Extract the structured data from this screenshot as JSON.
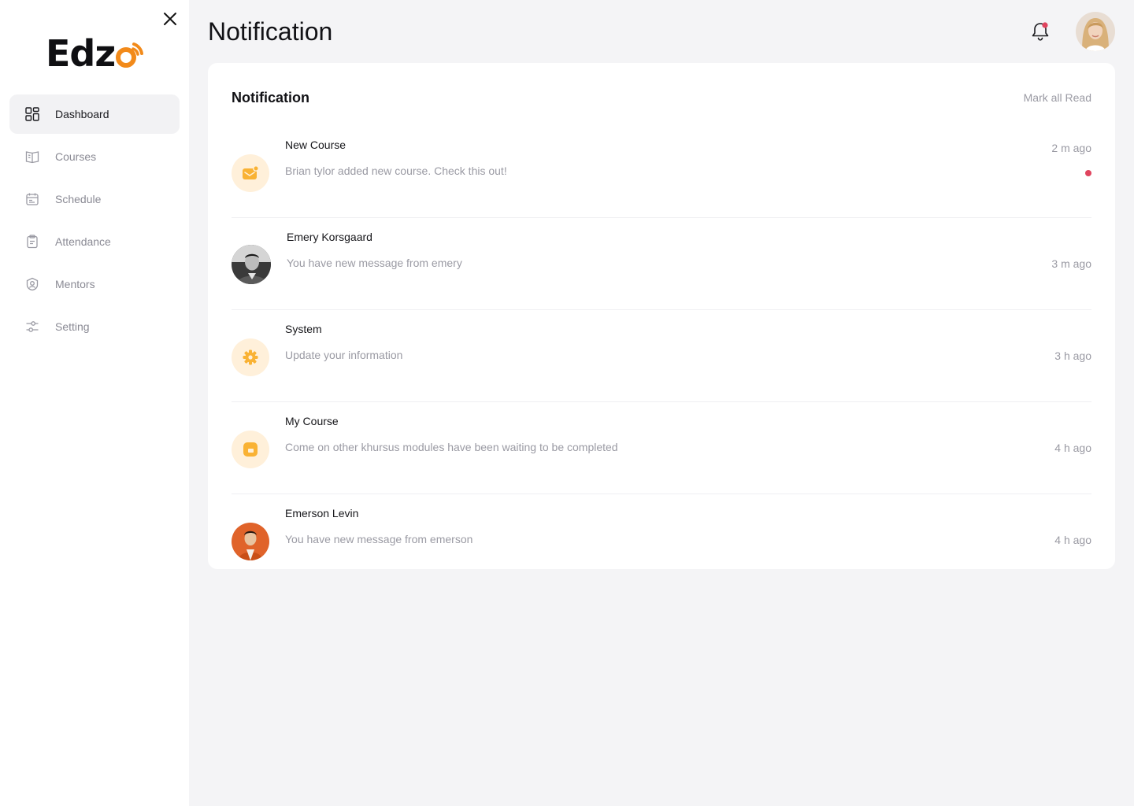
{
  "app": {
    "logo_text": "Edz",
    "accent_color": "#f28a1a"
  },
  "sidebar": {
    "items": [
      {
        "label": "Dashboard",
        "icon": "grid-icon",
        "active": true
      },
      {
        "label": "Courses",
        "icon": "book-icon",
        "active": false
      },
      {
        "label": "Schedule",
        "icon": "calendar-icon",
        "active": false
      },
      {
        "label": "Attendance",
        "icon": "clipboard-icon",
        "active": false
      },
      {
        "label": "Mentors",
        "icon": "user-badge-icon",
        "active": false
      },
      {
        "label": "Setting",
        "icon": "sliders-icon",
        "active": false
      }
    ]
  },
  "header": {
    "title": "Notification",
    "bell_has_unread": true
  },
  "panel": {
    "title": "Notification",
    "mark_all_label": "Mark all Read",
    "notifications": [
      {
        "title": "New Course",
        "message": "Brian tylor added new course. Check this out!",
        "time": "2 m ago",
        "icon": "mail-icon",
        "unread": true
      },
      {
        "title": "Emery Korsgaard",
        "message": "You have new message from emery",
        "time": "3 m ago",
        "icon": "avatar-photo",
        "unread": false
      },
      {
        "title": "System",
        "message": "Update your information",
        "time": "3 h ago",
        "icon": "gear-icon",
        "unread": false
      },
      {
        "title": "My Course",
        "message": "Come on other khursus modules have been waiting to be completed",
        "time": "4 h ago",
        "icon": "module-icon",
        "unread": false
      },
      {
        "title": "Emerson Levin",
        "message": "You have new message from emerson",
        "time": "4 h ago",
        "icon": "avatar-photo",
        "unread": false
      }
    ]
  }
}
